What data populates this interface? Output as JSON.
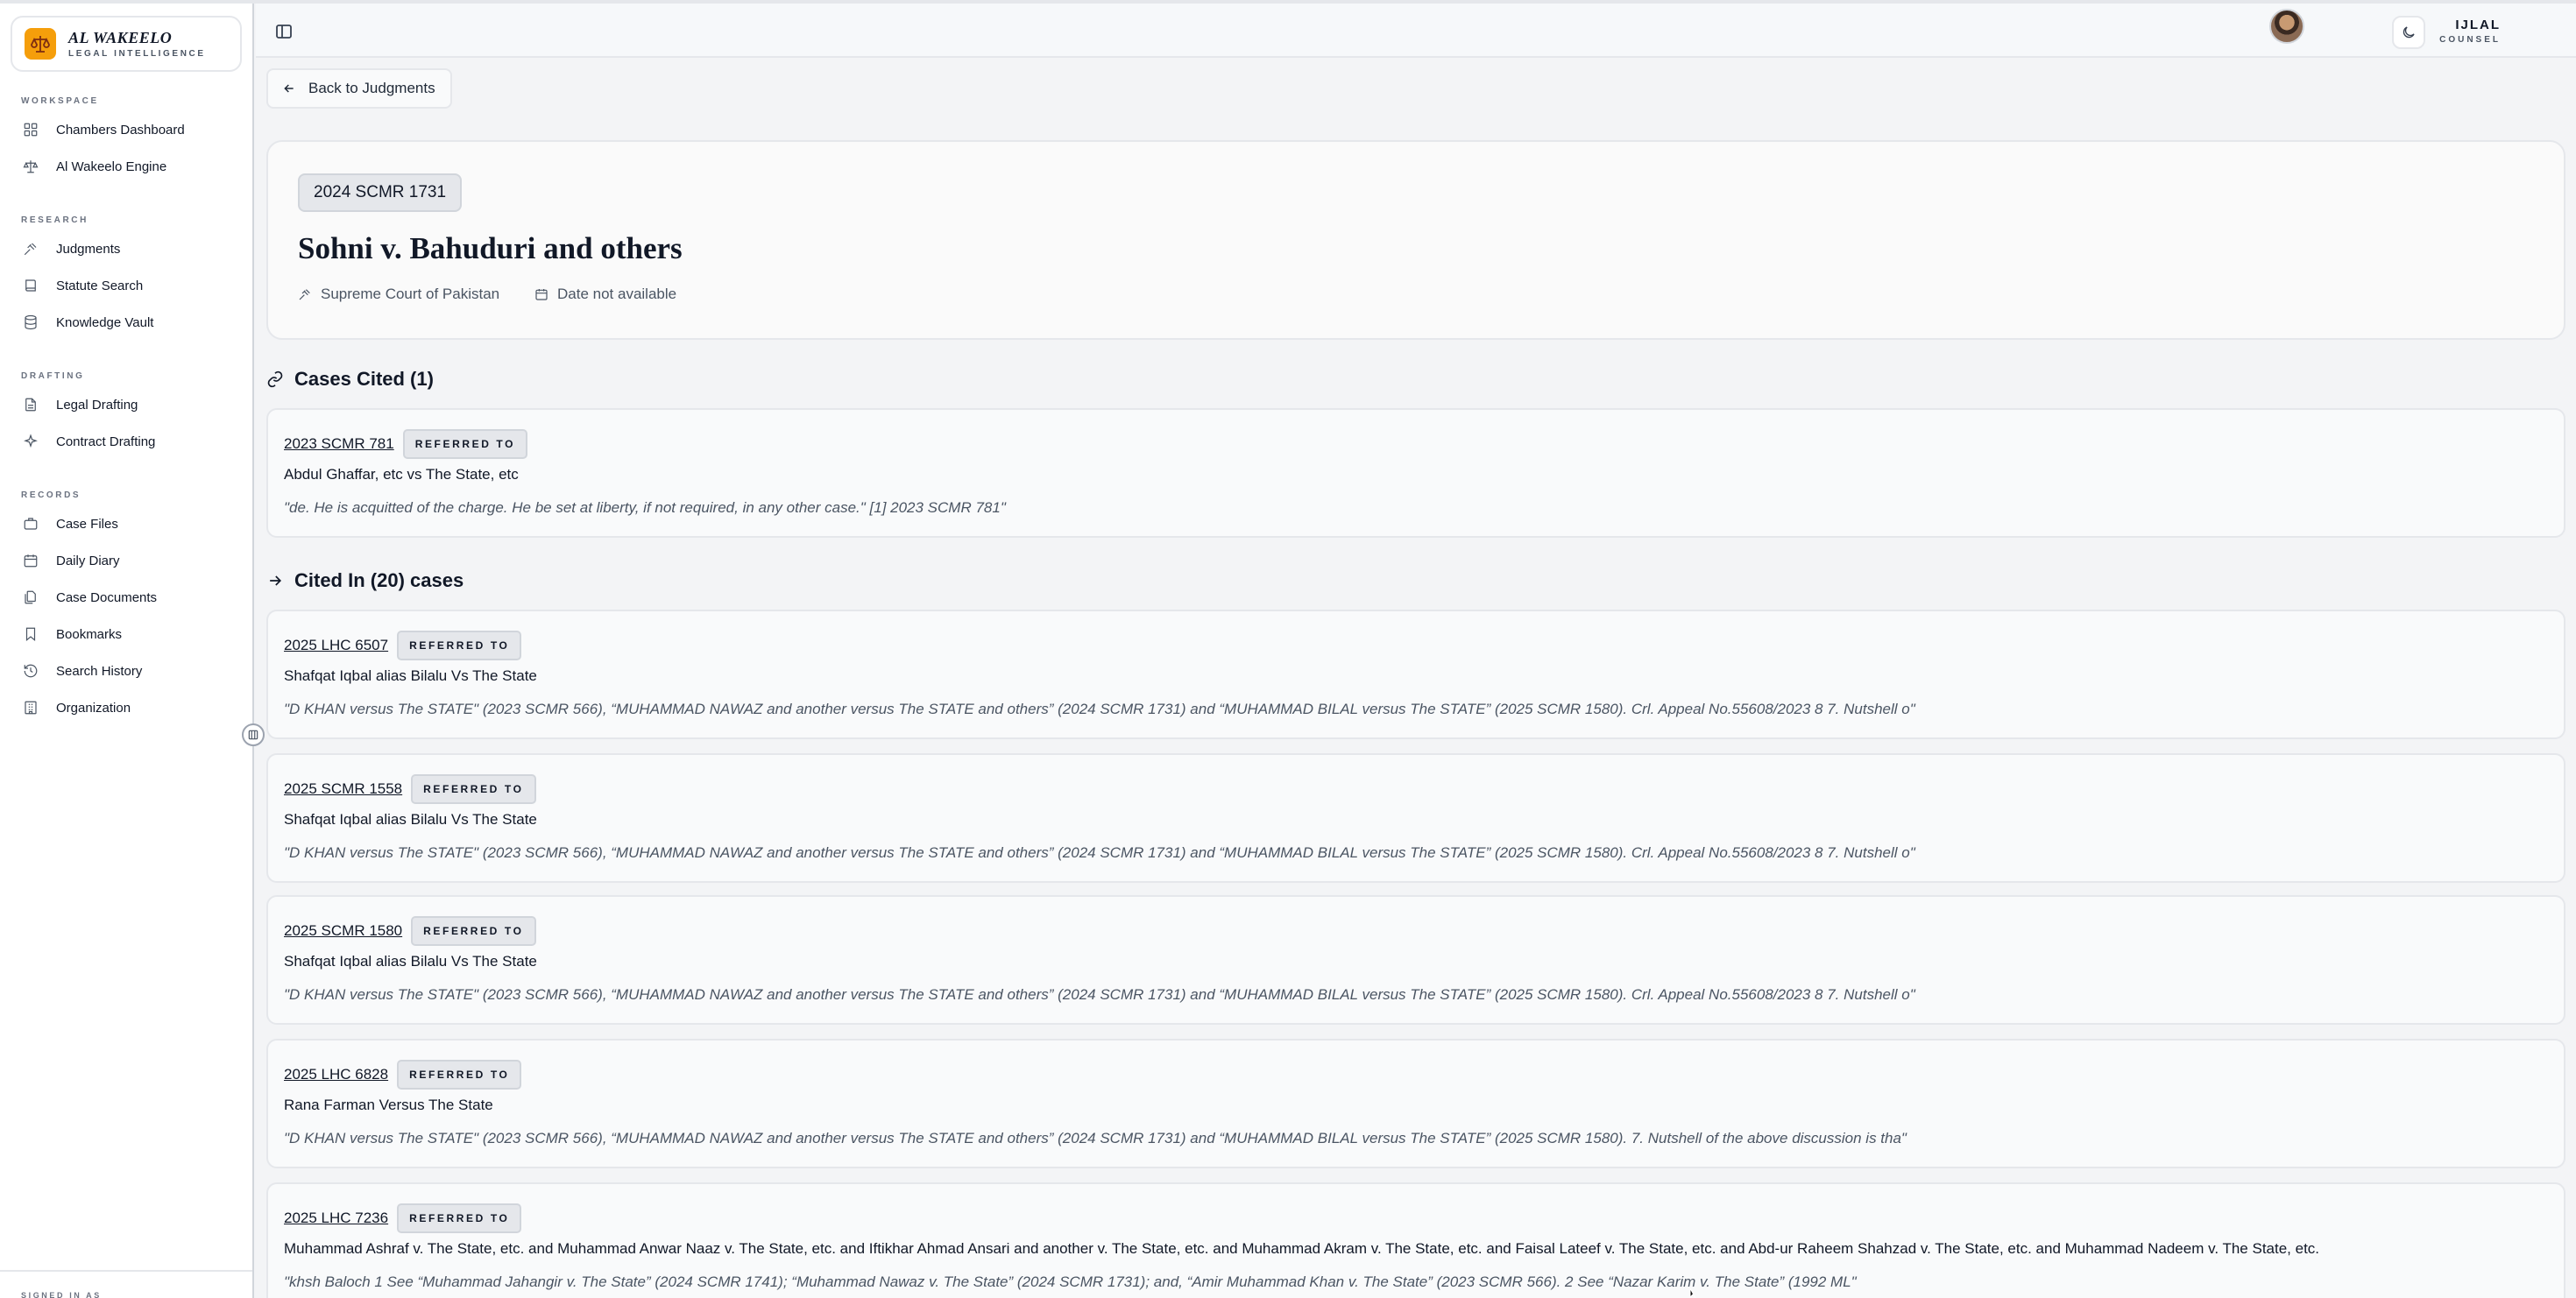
{
  "brand": {
    "name": "AL WAKEELO",
    "subtitle": "LEGAL INTELLIGENCE"
  },
  "sidebar": {
    "sections": [
      {
        "label": "WORKSPACE",
        "items": [
          {
            "label": "Chambers Dashboard",
            "icon": "grid-icon"
          },
          {
            "label": "Al Wakeelo Engine",
            "icon": "scale-icon"
          }
        ]
      },
      {
        "label": "RESEARCH",
        "items": [
          {
            "label": "Judgments",
            "icon": "gavel-icon"
          },
          {
            "label": "Statute Search",
            "icon": "book-icon"
          },
          {
            "label": "Knowledge Vault",
            "icon": "database-icon"
          }
        ]
      },
      {
        "label": "DRAFTING",
        "items": [
          {
            "label": "Legal Drafting",
            "icon": "file-text-icon"
          },
          {
            "label": "Contract Drafting",
            "icon": "sparkles-icon"
          }
        ]
      },
      {
        "label": "RECORDS",
        "items": [
          {
            "label": "Case Files",
            "icon": "briefcase-icon"
          },
          {
            "label": "Daily Diary",
            "icon": "calendar-icon"
          },
          {
            "label": "Case Documents",
            "icon": "files-icon"
          },
          {
            "label": "Bookmarks",
            "icon": "bookmark-icon"
          },
          {
            "label": "Search History",
            "icon": "history-icon"
          },
          {
            "label": "Organization",
            "icon": "building-icon"
          }
        ]
      }
    ],
    "signed_in_label": "SIGNED IN AS"
  },
  "topbar": {
    "user_name": "IJLAL",
    "user_role": "COUNSEL"
  },
  "back_button": "Back to Judgments",
  "judgment": {
    "citation": "2024 SCMR 1731",
    "title": "Sohni v. Bahuduri and others",
    "court": "Supreme Court of Pakistan",
    "date": "Date not available"
  },
  "cases_cited": {
    "heading": "Cases Cited (1)",
    "items": [
      {
        "citation": "2023 SCMR 781",
        "relation": "REFERRED TO",
        "name": "Abdul Ghaffar, etc vs The State, etc",
        "quote": "\"de. He is acquitted of the charge. He be set at liberty, if not required, in any other case.\" [1] 2023 SCMR 781\""
      }
    ]
  },
  "cited_in": {
    "heading": "Cited In (20) cases",
    "items": [
      {
        "citation": "2025 LHC 6507",
        "relation": "REFERRED TO",
        "name": "Shafqat Iqbal alias Bilalu Vs The State",
        "quote": "\"D KHAN versus The STATE\" (2023 SCMR 566), “MUHAMMAD NAWAZ and another versus The STATE and others” (2024 SCMR 1731) and “MUHAMMAD BILAL versus The STATE” (2025 SCMR 1580). Crl. Appeal No.55608/2023 8 7. Nutshell o\""
      },
      {
        "citation": "2025 SCMR 1558",
        "relation": "REFERRED TO",
        "name": "Shafqat Iqbal alias Bilalu Vs The State",
        "quote": "\"D KHAN versus The STATE\" (2023 SCMR 566), “MUHAMMAD NAWAZ and another versus The STATE and others” (2024 SCMR 1731) and “MUHAMMAD BILAL versus The STATE” (2025 SCMR 1580). Crl. Appeal No.55608/2023 8 7. Nutshell o\""
      },
      {
        "citation": "2025 SCMR 1580",
        "relation": "REFERRED TO",
        "name": "Shafqat Iqbal alias Bilalu Vs The State",
        "quote": "\"D KHAN versus The STATE\" (2023 SCMR 566), “MUHAMMAD NAWAZ and another versus The STATE and others” (2024 SCMR 1731) and “MUHAMMAD BILAL versus The STATE” (2025 SCMR 1580). Crl. Appeal No.55608/2023 8 7. Nutshell o\""
      },
      {
        "citation": "2025 LHC 6828",
        "relation": "REFERRED TO",
        "name": "Rana Farman Versus The State",
        "quote": "\"D KHAN versus The STATE\" (2023 SCMR 566), “MUHAMMAD NAWAZ and another versus The STATE and others” (2024 SCMR 1731) and “MUHAMMAD BILAL versus The STATE” (2025 SCMR 1580). 7. Nutshell of the above discussion is tha\""
      },
      {
        "citation": "2025 LHC 7236",
        "relation": "REFERRED TO",
        "name": "Muhammad Ashraf v. The State, etc. and Muhammad Anwar Naaz v. The State, etc. and Iftikhar Ahmad Ansari and another v. The State, etc. and Muhammad Akram v. The State, etc. and Faisal Lateef v. The State, etc. and Abd-ur Raheem Shahzad v. The State, etc. and Muhammad Nadeem v. The State, etc.",
        "quote": "\"khsh Baloch 1 See “Muhammad Jahangir v. The State” (2024 SCMR 1741); “Muhammad Nawaz v. The State” (2024 SCMR 1731); and, “Amir Muhammad Khan v. The State” (2023 SCMR 566). 2 See “Nazar Karim v. The State” (1992 ML\""
      }
    ]
  }
}
